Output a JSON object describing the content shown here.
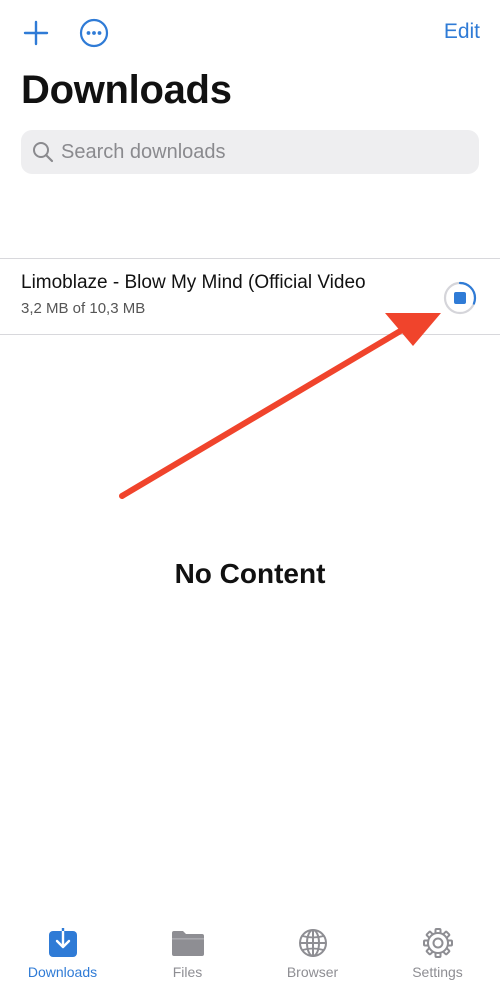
{
  "header": {
    "add_icon": "plus-icon",
    "more_icon": "ellipsis-circle-icon",
    "edit_label": "Edit",
    "title": "Downloads"
  },
  "search": {
    "placeholder": "Search downloads",
    "icon": "search-icon"
  },
  "downloads": [
    {
      "title": "Limoblaze - Blow My Mind (Official Video",
      "progress_text": "3,2 MB of 10,3 MB",
      "progress_fraction": 0.31,
      "action_icon": "stop-download-icon"
    }
  ],
  "empty_state": "No Content",
  "tabs": [
    {
      "label": "Downloads",
      "icon": "download-tray-icon",
      "active": true
    },
    {
      "label": "Files",
      "icon": "folder-icon",
      "active": false
    },
    {
      "label": "Browser",
      "icon": "globe-icon",
      "active": false
    },
    {
      "label": "Settings",
      "icon": "gear-icon",
      "active": false
    }
  ],
  "colors": {
    "accent": "#2f7bd6",
    "annotation_arrow": "#f0442c",
    "inactive": "#8e8e93"
  }
}
